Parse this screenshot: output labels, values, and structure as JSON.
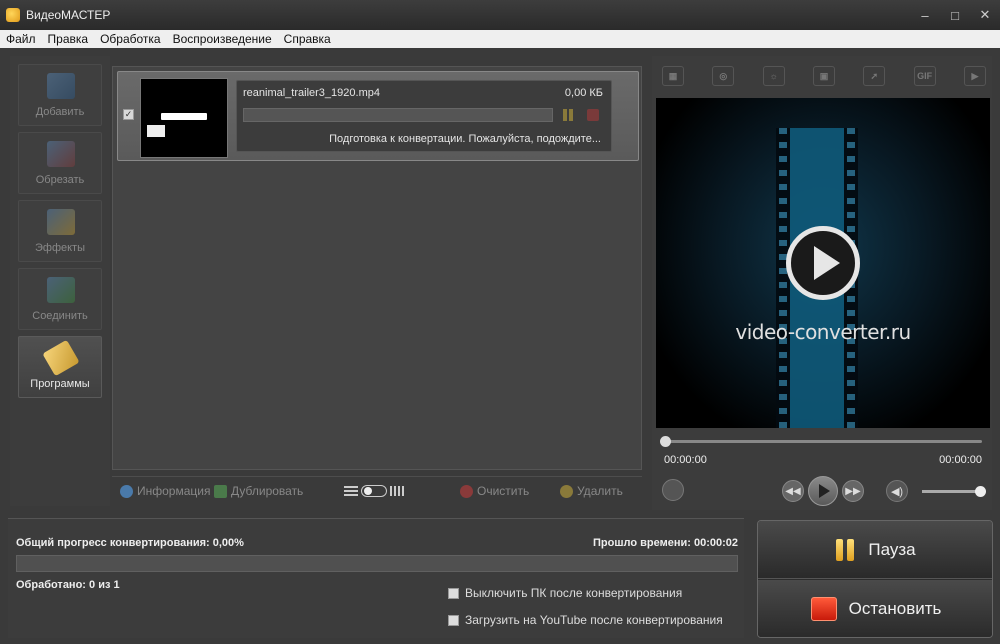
{
  "window": {
    "title": "ВидеоМАСТЕР",
    "minimize": "–",
    "restore": "□",
    "close": "✕"
  },
  "menu": [
    "Файл",
    "Правка",
    "Обработка",
    "Воспроизведение",
    "Справка"
  ],
  "tools": [
    {
      "label": "Добавить",
      "icon": "add-video-icon"
    },
    {
      "label": "Обрезать",
      "icon": "cut-video-icon"
    },
    {
      "label": "Эффекты",
      "icon": "effects-icon"
    },
    {
      "label": "Соединить",
      "icon": "join-icon"
    },
    {
      "label": "Программы",
      "icon": "programs-icon",
      "active": true
    }
  ],
  "file": {
    "name": "reanimal_trailer3_1920.mp4",
    "size": "0,00 КБ",
    "status": "Подготовка к конвертации. Пожалуйста, подождите...",
    "checked": true,
    "check_mark": "✓"
  },
  "list_toolbar": {
    "info": "Информация",
    "duplicate": "Дублировать",
    "clear": "Очистить",
    "delete": "Удалить"
  },
  "effects": [
    "crop-icon",
    "vignette-icon",
    "brightness-icon",
    "stabilize-icon",
    "speed-icon",
    "GIF",
    "screen-icon"
  ],
  "preview": {
    "brand": "video-converter.ru",
    "time_current": "00:00:00",
    "time_total": "00:00:00",
    "volume_level": 1.0
  },
  "controls": {
    "prev": "◀◀",
    "next": "▶▶",
    "volume": "◀)"
  },
  "progress": {
    "overall_label": "Общий прогресс конвертирования: 0,00%",
    "overall_value": 0.0,
    "elapsed_label": "Прошло времени: 00:00:02",
    "processed_label": "Обработано: 0 из 1",
    "shutdown_label": "Выключить ПК после конвертирования",
    "youtube_label": "Загрузить на YouTube после конвертирования"
  },
  "actions": {
    "pause": "Пауза",
    "stop": "Остановить"
  },
  "colors": {
    "accent_pause": "#f0b030",
    "accent_stop": "#e03018"
  }
}
